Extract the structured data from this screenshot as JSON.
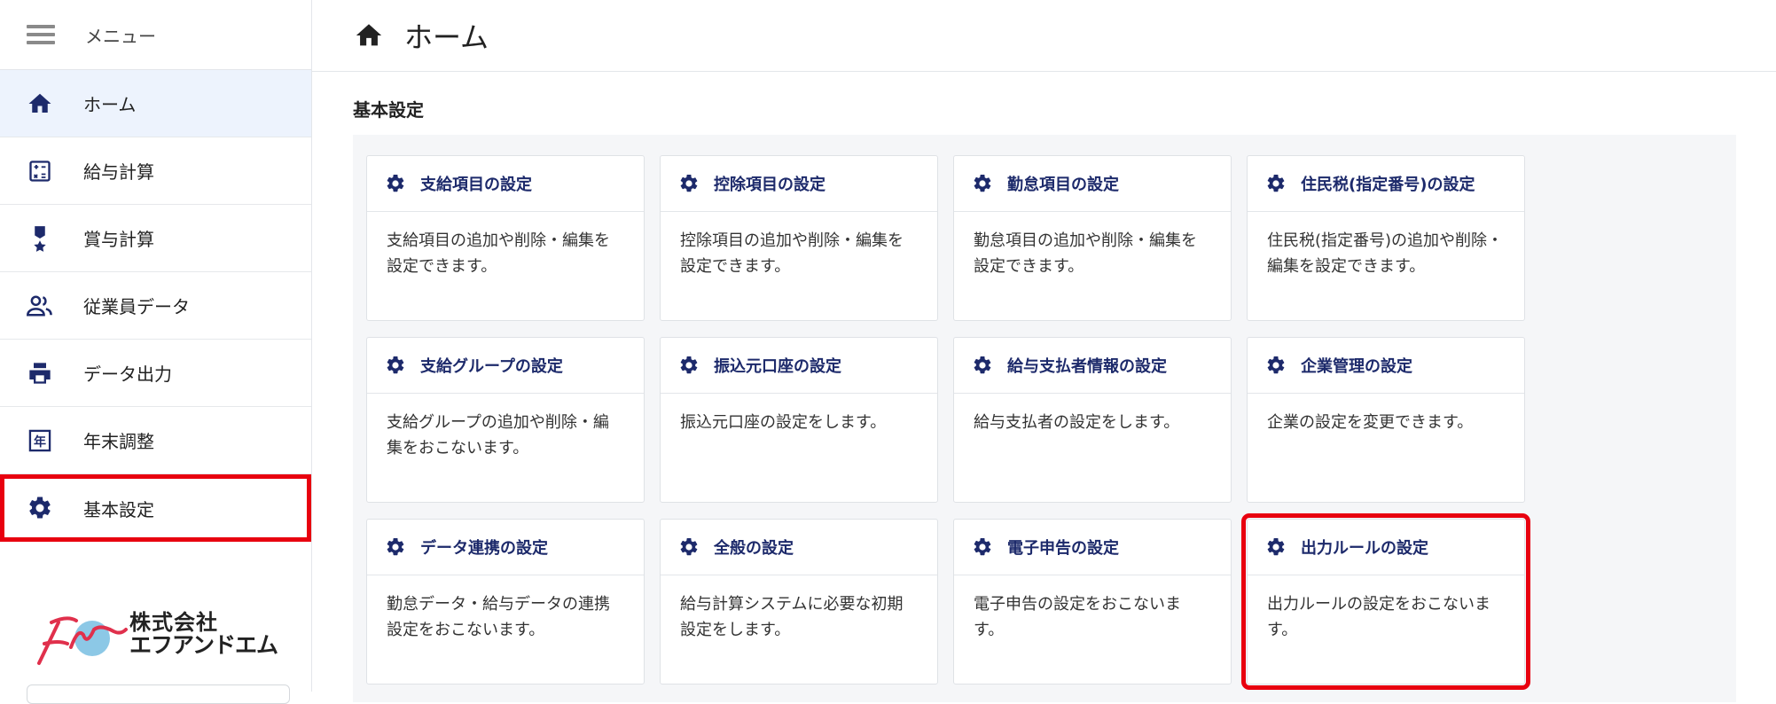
{
  "menu_label": "メニュー",
  "nav": [
    {
      "name": "nav-item-home",
      "icon": "home-icon",
      "label": "ホーム"
    },
    {
      "name": "nav-item-payroll",
      "icon": "calculator-icon",
      "label": "給与計算"
    },
    {
      "name": "nav-item-bonus",
      "icon": "medal-icon",
      "label": "賞与計算"
    },
    {
      "name": "nav-item-employee-data",
      "icon": "people-icon",
      "label": "従業員データ"
    },
    {
      "name": "nav-item-data-output",
      "icon": "printer-icon",
      "label": "データ出力"
    },
    {
      "name": "nav-item-year-end",
      "icon": "year-calendar-icon",
      "label": "年末調整"
    },
    {
      "name": "nav-item-basic-settings",
      "icon": "gear-icon",
      "label": "基本設定"
    }
  ],
  "logo": {
    "line1": "株式会社",
    "line2": "エフアンドエム"
  },
  "header": {
    "title": "ホーム"
  },
  "section_title": "基本設定",
  "cards": [
    {
      "title": "支給項目の設定",
      "desc": "支給項目の追加や削除・編集を設定できます。"
    },
    {
      "title": "控除項目の設定",
      "desc": "控除項目の追加や削除・編集を設定できます。"
    },
    {
      "title": "勤怠項目の設定",
      "desc": "勤怠項目の追加や削除・編集を設定できます。"
    },
    {
      "title": "住民税(指定番号)の設定",
      "desc": "住民税(指定番号)の追加や削除・編集を設定できます。"
    },
    {
      "title": "支給グループの設定",
      "desc": "支給グループの追加や削除・編集をおこないます。"
    },
    {
      "title": "振込元口座の設定",
      "desc": "振込元口座の設定をします。"
    },
    {
      "title": "給与支払者情報の設定",
      "desc": "給与支払者の設定をします。"
    },
    {
      "title": "企業管理の設定",
      "desc": "企業の設定を変更できます。"
    },
    {
      "title": "データ連携の設定",
      "desc": "勤怠データ・給与データの連携設定をおこないます。"
    },
    {
      "title": "全般の設定",
      "desc": "給与計算システムに必要な初期設定をします。"
    },
    {
      "title": "電子申告の設定",
      "desc": "電子申告の設定をおこないます。"
    },
    {
      "title": "出力ルールの設定",
      "desc": "出力ルールの設定をおこないます。"
    }
  ],
  "colors": {
    "accent": "#1d2a6b",
    "highlight": "#e8000f",
    "active_bg": "#edf3fd"
  }
}
